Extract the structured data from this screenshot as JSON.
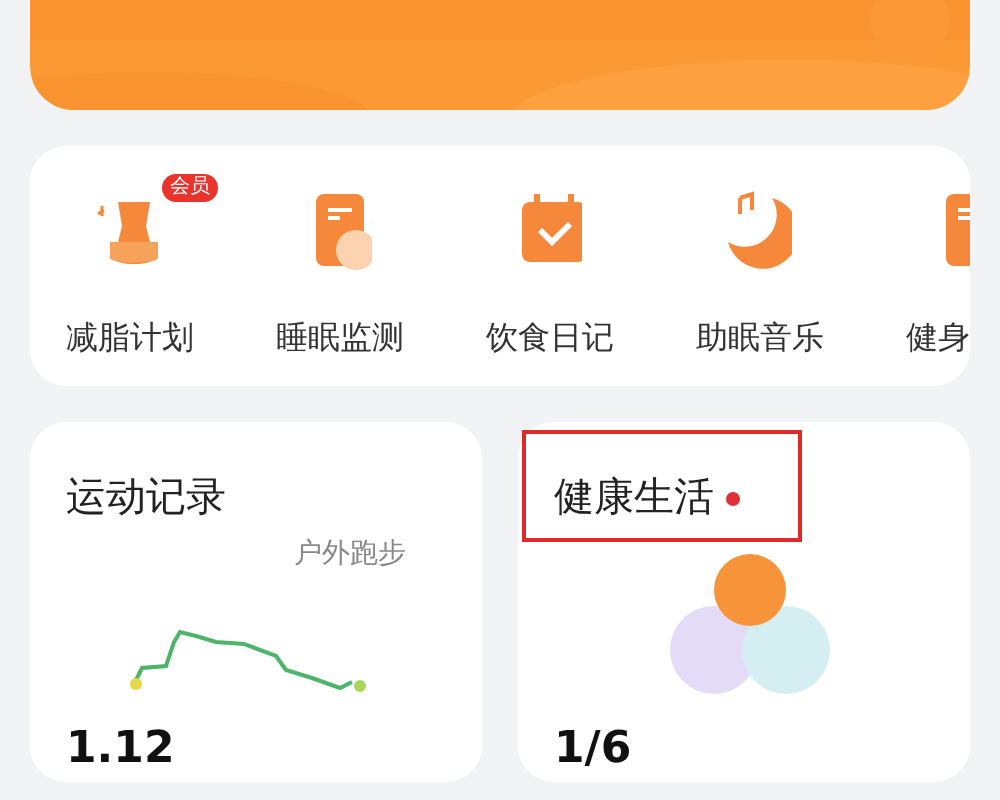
{
  "shortcuts": [
    {
      "label": "减脂计划",
      "badge": "会员"
    },
    {
      "label": "睡眠监测"
    },
    {
      "label": "饮食日记"
    },
    {
      "label": "助眠音乐"
    },
    {
      "label": "健身"
    }
  ],
  "cards": [
    {
      "kind": "route",
      "title": "运动记录",
      "subtitle": "户外跑步",
      "value": "1.12",
      "unread": false,
      "highlighted": false
    },
    {
      "kind": "bubbles",
      "title": "健康生活",
      "value": "1/6",
      "unread": true,
      "highlighted": true
    }
  ]
}
